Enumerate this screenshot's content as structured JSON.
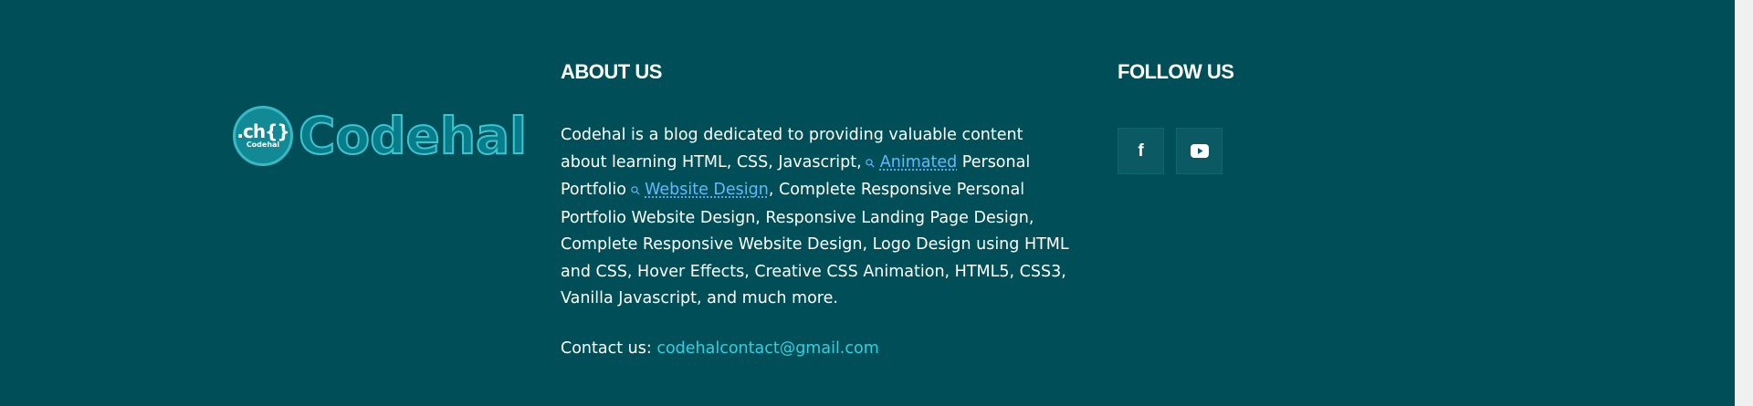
{
  "logo": {
    "badge_mark": ".ch{}",
    "badge_text": "Codehal",
    "wordmark": "Codehal"
  },
  "about": {
    "heading": "ABOUT US",
    "text_part1": "Codehal is a blog dedicated to providing valuable content about learning HTML, CSS, Javascript, ",
    "keyword1": "Animated",
    "text_part2": " Personal Portfolio ",
    "keyword2": "Website Design",
    "text_part3": ", Complete Responsive Personal Portfolio Website Design, Responsive Landing Page Design, Complete Responsive Website Design, Logo Design using HTML and CSS, Hover Effects, Creative CSS Animation, HTML5, CSS3, Vanilla Javascript, and much more.",
    "contact_label": "Contact us: ",
    "contact_email": "codehalcontact@gmail.com"
  },
  "follow": {
    "heading": "FOLLOW US",
    "icons": [
      "facebook-icon",
      "youtube-icon"
    ]
  },
  "colors": {
    "footer_bg": "#004f58",
    "link_keyword": "#63b8ff",
    "email": "#31d0e0",
    "social_bg": "#0b5962"
  }
}
